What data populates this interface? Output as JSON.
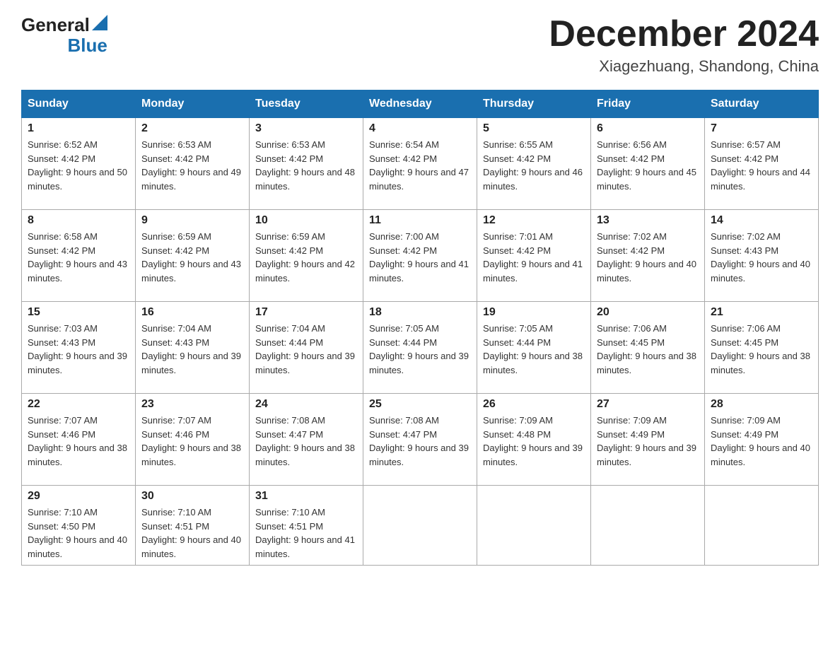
{
  "header": {
    "logo_general": "General",
    "logo_blue": "Blue",
    "month_title": "December 2024",
    "location": "Xiagezhuang, Shandong, China"
  },
  "weekdays": [
    "Sunday",
    "Monday",
    "Tuesday",
    "Wednesday",
    "Thursday",
    "Friday",
    "Saturday"
  ],
  "weeks": [
    [
      {
        "day": "1",
        "sunrise": "6:52 AM",
        "sunset": "4:42 PM",
        "daylight": "9 hours and 50 minutes."
      },
      {
        "day": "2",
        "sunrise": "6:53 AM",
        "sunset": "4:42 PM",
        "daylight": "9 hours and 49 minutes."
      },
      {
        "day": "3",
        "sunrise": "6:53 AM",
        "sunset": "4:42 PM",
        "daylight": "9 hours and 48 minutes."
      },
      {
        "day": "4",
        "sunrise": "6:54 AM",
        "sunset": "4:42 PM",
        "daylight": "9 hours and 47 minutes."
      },
      {
        "day": "5",
        "sunrise": "6:55 AM",
        "sunset": "4:42 PM",
        "daylight": "9 hours and 46 minutes."
      },
      {
        "day": "6",
        "sunrise": "6:56 AM",
        "sunset": "4:42 PM",
        "daylight": "9 hours and 45 minutes."
      },
      {
        "day": "7",
        "sunrise": "6:57 AM",
        "sunset": "4:42 PM",
        "daylight": "9 hours and 44 minutes."
      }
    ],
    [
      {
        "day": "8",
        "sunrise": "6:58 AM",
        "sunset": "4:42 PM",
        "daylight": "9 hours and 43 minutes."
      },
      {
        "day": "9",
        "sunrise": "6:59 AM",
        "sunset": "4:42 PM",
        "daylight": "9 hours and 43 minutes."
      },
      {
        "day": "10",
        "sunrise": "6:59 AM",
        "sunset": "4:42 PM",
        "daylight": "9 hours and 42 minutes."
      },
      {
        "day": "11",
        "sunrise": "7:00 AM",
        "sunset": "4:42 PM",
        "daylight": "9 hours and 41 minutes."
      },
      {
        "day": "12",
        "sunrise": "7:01 AM",
        "sunset": "4:42 PM",
        "daylight": "9 hours and 41 minutes."
      },
      {
        "day": "13",
        "sunrise": "7:02 AM",
        "sunset": "4:42 PM",
        "daylight": "9 hours and 40 minutes."
      },
      {
        "day": "14",
        "sunrise": "7:02 AM",
        "sunset": "4:43 PM",
        "daylight": "9 hours and 40 minutes."
      }
    ],
    [
      {
        "day": "15",
        "sunrise": "7:03 AM",
        "sunset": "4:43 PM",
        "daylight": "9 hours and 39 minutes."
      },
      {
        "day": "16",
        "sunrise": "7:04 AM",
        "sunset": "4:43 PM",
        "daylight": "9 hours and 39 minutes."
      },
      {
        "day": "17",
        "sunrise": "7:04 AM",
        "sunset": "4:44 PM",
        "daylight": "9 hours and 39 minutes."
      },
      {
        "day": "18",
        "sunrise": "7:05 AM",
        "sunset": "4:44 PM",
        "daylight": "9 hours and 39 minutes."
      },
      {
        "day": "19",
        "sunrise": "7:05 AM",
        "sunset": "4:44 PM",
        "daylight": "9 hours and 38 minutes."
      },
      {
        "day": "20",
        "sunrise": "7:06 AM",
        "sunset": "4:45 PM",
        "daylight": "9 hours and 38 minutes."
      },
      {
        "day": "21",
        "sunrise": "7:06 AM",
        "sunset": "4:45 PM",
        "daylight": "9 hours and 38 minutes."
      }
    ],
    [
      {
        "day": "22",
        "sunrise": "7:07 AM",
        "sunset": "4:46 PM",
        "daylight": "9 hours and 38 minutes."
      },
      {
        "day": "23",
        "sunrise": "7:07 AM",
        "sunset": "4:46 PM",
        "daylight": "9 hours and 38 minutes."
      },
      {
        "day": "24",
        "sunrise": "7:08 AM",
        "sunset": "4:47 PM",
        "daylight": "9 hours and 38 minutes."
      },
      {
        "day": "25",
        "sunrise": "7:08 AM",
        "sunset": "4:47 PM",
        "daylight": "9 hours and 39 minutes."
      },
      {
        "day": "26",
        "sunrise": "7:09 AM",
        "sunset": "4:48 PM",
        "daylight": "9 hours and 39 minutes."
      },
      {
        "day": "27",
        "sunrise": "7:09 AM",
        "sunset": "4:49 PM",
        "daylight": "9 hours and 39 minutes."
      },
      {
        "day": "28",
        "sunrise": "7:09 AM",
        "sunset": "4:49 PM",
        "daylight": "9 hours and 40 minutes."
      }
    ],
    [
      {
        "day": "29",
        "sunrise": "7:10 AM",
        "sunset": "4:50 PM",
        "daylight": "9 hours and 40 minutes."
      },
      {
        "day": "30",
        "sunrise": "7:10 AM",
        "sunset": "4:51 PM",
        "daylight": "9 hours and 40 minutes."
      },
      {
        "day": "31",
        "sunrise": "7:10 AM",
        "sunset": "4:51 PM",
        "daylight": "9 hours and 41 minutes."
      },
      null,
      null,
      null,
      null
    ]
  ],
  "labels": {
    "sunrise": "Sunrise:",
    "sunset": "Sunset:",
    "daylight": "Daylight:"
  }
}
